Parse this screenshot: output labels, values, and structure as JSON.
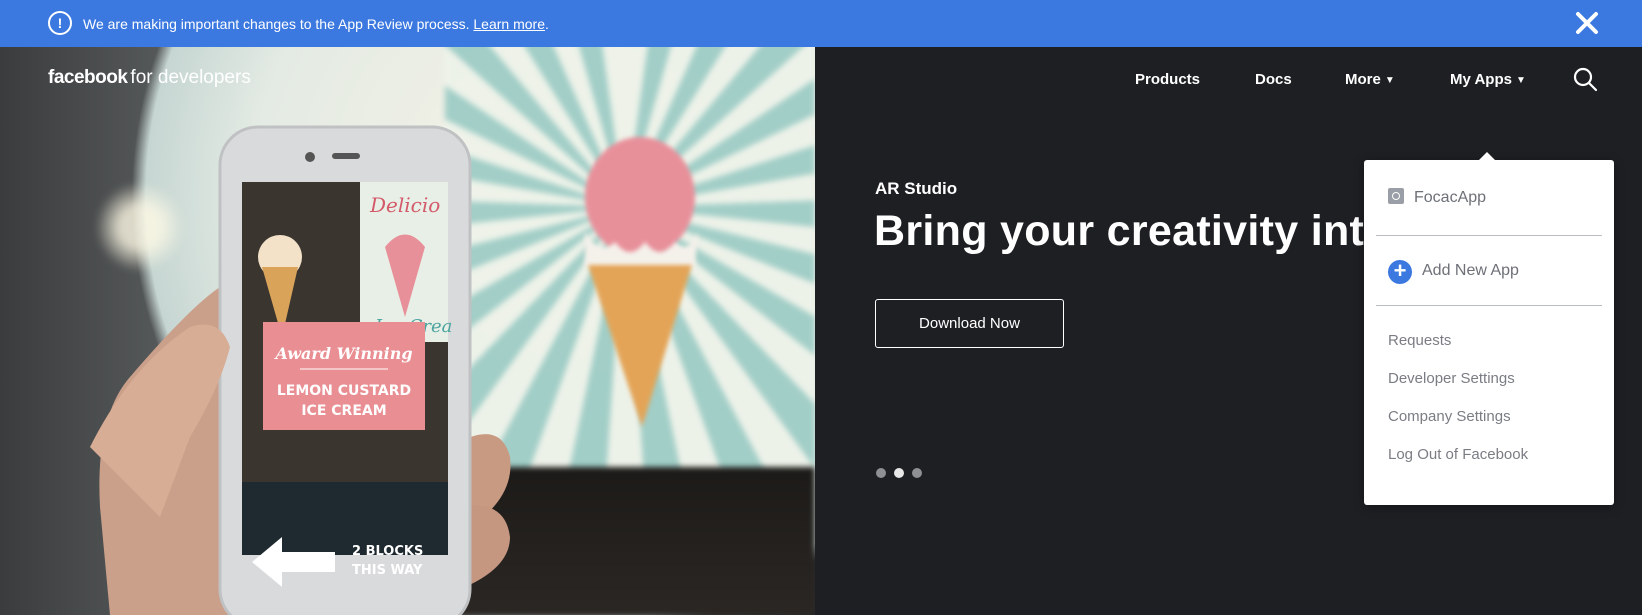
{
  "banner": {
    "icon": "info-icon",
    "message": "We are making important changes to the App Review process.",
    "link_text": "Learn more",
    "trailing": ".",
    "close_icon": "close-icon",
    "color": "#3b79e0"
  },
  "header": {
    "logo_brand": "facebook",
    "logo_suffix": "for developers",
    "nav": [
      {
        "label": "Products",
        "has_caret": false
      },
      {
        "label": "Docs",
        "has_caret": false
      },
      {
        "label": "More",
        "caret": "▼"
      },
      {
        "label": "My Apps",
        "caret": "▼"
      }
    ],
    "search_icon": "search-icon"
  },
  "hero": {
    "eyebrow": "AR Studio",
    "headline": "Bring your creativity into",
    "cta_label": "Download Now",
    "carousel_dots": 3,
    "active_dot": 1,
    "image_text": {
      "poster_top": "Delicio",
      "poster_bottom": "Ice Crea",
      "award": "Award Winning",
      "product_line1": "LEMON CUSTARD",
      "product_line2": "ICE CREAM",
      "blocks_line1": "2 BLOCKS",
      "blocks_line2": "THIS WAY"
    }
  },
  "my_apps_menu": {
    "app_name": "FocacApp",
    "add_label": "Add New App",
    "links": [
      "Requests",
      "Developer Settings",
      "Company Settings",
      "Log Out of Facebook"
    ]
  }
}
